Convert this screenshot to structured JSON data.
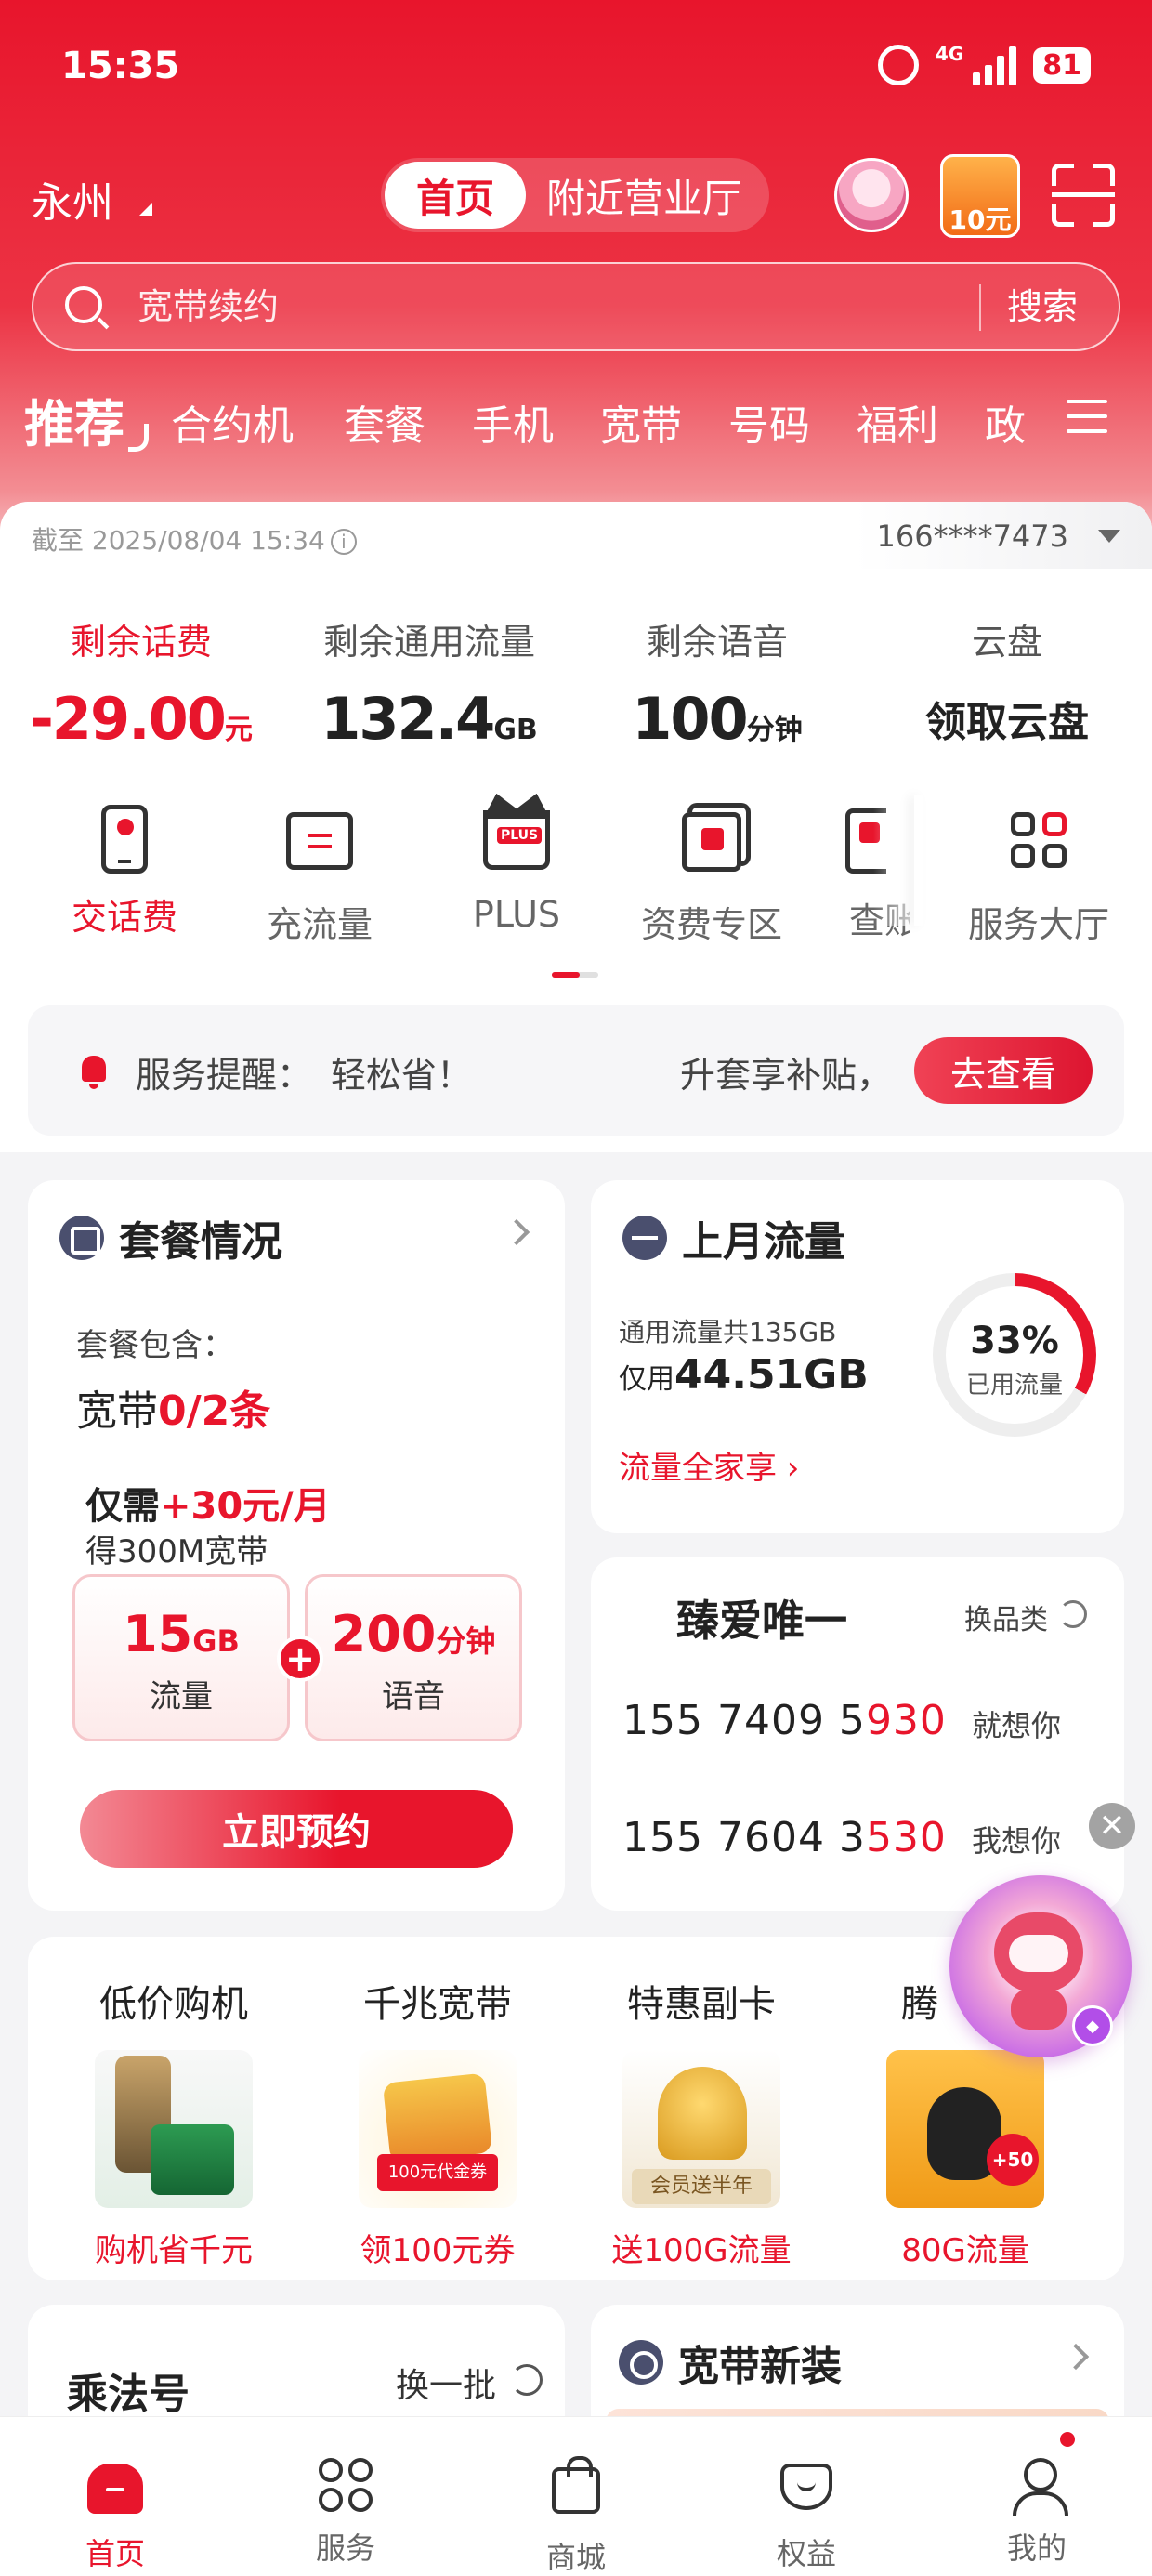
{
  "status_bar": {
    "time": "15:35",
    "network": "4G",
    "battery": "81"
  },
  "header": {
    "city": "永州",
    "tabs": [
      {
        "label": "首页",
        "active": true
      },
      {
        "label": "附近营业厅",
        "active": false
      }
    ],
    "coupon_label": "10元",
    "avatar_icon": "mascot-avatar-icon",
    "scan_icon": "scan-icon"
  },
  "search": {
    "placeholder": "宽带续约",
    "button": "搜索"
  },
  "categories": {
    "highlight": "推荐",
    "items": [
      "合约机",
      "套餐",
      "手机",
      "宽带",
      "号码",
      "福利",
      "政"
    ],
    "menu_icon": "menu-icon"
  },
  "account": {
    "as_of": "截至 2025/08/04 15:34",
    "phone": "166****7473",
    "stats": [
      {
        "label": "剩余话费",
        "value": "-29.00",
        "unit": "元",
        "accent": true
      },
      {
        "label": "剩余通用流量",
        "value": "132.4",
        "unit": "GB",
        "accent": false
      },
      {
        "label": "剩余语音",
        "value": "100",
        "unit": "分钟",
        "accent": false
      },
      {
        "label": "云盘",
        "value": "领取云盘",
        "unit": "",
        "accent": false
      }
    ],
    "quick": [
      {
        "label": "交话费",
        "icon": "phone-bill-icon",
        "active": true
      },
      {
        "label": "充流量",
        "icon": "data-topup-icon",
        "active": false
      },
      {
        "label": "PLUS",
        "icon": "plus-crown-icon",
        "active": false
      },
      {
        "label": "资费专区",
        "icon": "tariff-icon",
        "active": false
      },
      {
        "label": "查账",
        "icon": "bill-query-icon",
        "active": false
      },
      {
        "label": "服务大厅",
        "icon": "service-hall-icon",
        "active": false
      }
    ],
    "plus_badge": "PLUS"
  },
  "notice": {
    "label": "服务提醒：",
    "text": "轻松省！",
    "right_text": "升套享补贴，",
    "button": "去查看"
  },
  "package": {
    "title": "套餐情况",
    "includes_label": "套餐包含：",
    "broadband_prefix": "宽带",
    "broadband_value": "0/2条",
    "price_prefix": "仅需",
    "price_value": "+30元/月",
    "price_sub": "得300M宽带",
    "boxes": [
      {
        "value": "15",
        "unit": "GB",
        "label": "流量"
      },
      {
        "value": "200",
        "unit": "分钟",
        "label": "语音"
      }
    ],
    "plus_sign": "+",
    "cta": "立即预约"
  },
  "last_month_data": {
    "title": "上月流量",
    "total": "通用流量共135GB",
    "used_prefix": "仅用",
    "used_value": "44.51GB",
    "percent": "33%",
    "percent_value": 33,
    "percent_label": "已用流量",
    "link": "流量全家享 ›"
  },
  "lucky_numbers": {
    "title": "臻爱唯一",
    "swap": "换品类",
    "items": [
      {
        "plain": "155 7409 5",
        "highlight": "930",
        "tag": "就想你"
      },
      {
        "plain": "155 7604 3",
        "highlight": "530",
        "tag": "我想你"
      }
    ]
  },
  "promos": [
    {
      "title": "低价购机",
      "subtitle": "购机省千元",
      "image": "phone-promo-image"
    },
    {
      "title": "千兆宽带",
      "subtitle": "领100元券",
      "image": "broadband-coupon-image"
    },
    {
      "title": "特惠副卡",
      "subtitle": "送100G流量",
      "image": "member-gift-image"
    },
    {
      "title": "腾",
      "subtitle": "80G流量",
      "image": "qq-data-image"
    }
  ],
  "multiply": {
    "title": "乘法号",
    "swap": "换一批"
  },
  "broadband_new": {
    "title": "宽带新装"
  },
  "floating": {
    "close": "✕"
  },
  "bottom_nav": [
    {
      "label": "首页",
      "active": true
    },
    {
      "label": "服务",
      "active": false
    },
    {
      "label": "商城",
      "active": false
    },
    {
      "label": "权益",
      "active": false
    },
    {
      "label": "我的",
      "active": false
    }
  ],
  "colors": {
    "brand": "#e8152c",
    "text": "#222222",
    "muted": "#666666"
  }
}
